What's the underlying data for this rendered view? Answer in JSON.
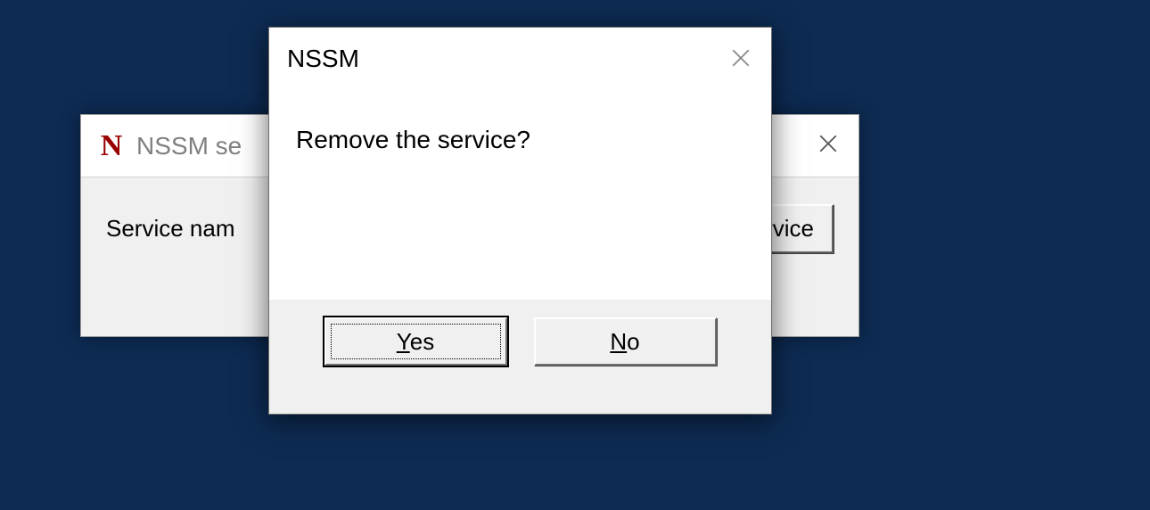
{
  "background_window": {
    "icon_letter": "N",
    "title": "NSSM se",
    "label": "Service nam",
    "button_visible_text": "ve service"
  },
  "dialog": {
    "title": "NSSM",
    "message": "Remove the service?",
    "yes_prefix": "Y",
    "yes_suffix": "es",
    "no_prefix": "N",
    "no_suffix": "o"
  }
}
